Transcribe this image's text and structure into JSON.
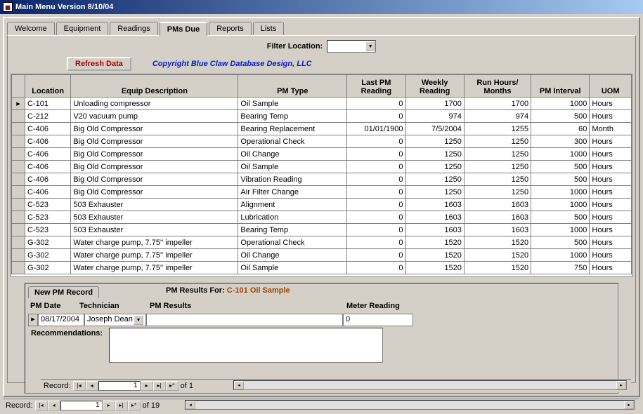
{
  "window": {
    "title": "Main Menu Version 8/10/04"
  },
  "tabs": [
    "Welcome",
    "Equipment",
    "Readings",
    "PMs Due",
    "Reports",
    "Lists"
  ],
  "activeTab": 3,
  "filter": {
    "label": "Filter Location:"
  },
  "refresh": {
    "label": "Refresh Data"
  },
  "copyright": "Copyright Blue Claw Database Design, LLC",
  "columns": [
    "Location",
    "Equip Description",
    "PM Type",
    "Last PM Reading",
    "Weekly Reading",
    "Run Hours/ Months",
    "PM Interval",
    "UOM"
  ],
  "rows": [
    {
      "loc": "C-101",
      "desc": "Unloading compressor",
      "pmtype": "Oil Sample",
      "last": "0",
      "weekly": "1700",
      "run": "1700",
      "interval": "1000",
      "uom": "Hours"
    },
    {
      "loc": "C-212",
      "desc": "V20 vacuum pump",
      "pmtype": "Bearing Temp",
      "last": "0",
      "weekly": "974",
      "run": "974",
      "interval": "500",
      "uom": "Hours"
    },
    {
      "loc": "C-406",
      "desc": "Big Old Compressor",
      "pmtype": "Bearing Replacement",
      "last": "01/01/1900",
      "weekly": "7/5/2004",
      "run": "1255",
      "interval": "60",
      "uom": "Month"
    },
    {
      "loc": "C-406",
      "desc": "Big Old Compressor",
      "pmtype": "Operational Check",
      "last": "0",
      "weekly": "1250",
      "run": "1250",
      "interval": "300",
      "uom": "Hours"
    },
    {
      "loc": "C-406",
      "desc": "Big Old Compressor",
      "pmtype": "Oil Change",
      "last": "0",
      "weekly": "1250",
      "run": "1250",
      "interval": "1000",
      "uom": "Hours"
    },
    {
      "loc": "C-406",
      "desc": "Big Old Compressor",
      "pmtype": "Oil Sample",
      "last": "0",
      "weekly": "1250",
      "run": "1250",
      "interval": "500",
      "uom": "Hours"
    },
    {
      "loc": "C-406",
      "desc": "Big Old Compressor",
      "pmtype": "Vibration Reading",
      "last": "0",
      "weekly": "1250",
      "run": "1250",
      "interval": "500",
      "uom": "Hours"
    },
    {
      "loc": "C-406",
      "desc": "Big Old Compressor",
      "pmtype": "Air Filter Change",
      "last": "0",
      "weekly": "1250",
      "run": "1250",
      "interval": "1000",
      "uom": "Hours"
    },
    {
      "loc": "C-523",
      "desc": "503 Exhauster",
      "pmtype": "Alignment",
      "last": "0",
      "weekly": "1603",
      "run": "1603",
      "interval": "1000",
      "uom": "Hours"
    },
    {
      "loc": "C-523",
      "desc": "503 Exhauster",
      "pmtype": "Lubrication",
      "last": "0",
      "weekly": "1603",
      "run": "1603",
      "interval": "500",
      "uom": "Hours"
    },
    {
      "loc": "C-523",
      "desc": "503 Exhauster",
      "pmtype": "Bearing Temp",
      "last": "0",
      "weekly": "1603",
      "run": "1603",
      "interval": "1000",
      "uom": "Hours"
    },
    {
      "loc": "G-302",
      "desc": "Water charge pump, 7.75'' impeller",
      "pmtype": "Operational Check",
      "last": "0",
      "weekly": "1520",
      "run": "1520",
      "interval": "500",
      "uom": "Hours"
    },
    {
      "loc": "G-302",
      "desc": "Water charge pump, 7.75'' impeller",
      "pmtype": "Oil Change",
      "last": "0",
      "weekly": "1520",
      "run": "1520",
      "interval": "1000",
      "uom": "Hours"
    },
    {
      "loc": "G-302",
      "desc": "Water charge pump, 7.75'' impeller",
      "pmtype": "Oil Sample",
      "last": "0",
      "weekly": "1520",
      "run": "1520",
      "interval": "750",
      "uom": "Hours"
    }
  ],
  "subpanel": {
    "tab": "New PM Record",
    "titlePrefix": "PM Results For:",
    "titleValue": "C-101 Oil Sample",
    "headers": [
      "PM Date",
      "Technician",
      "PM Results",
      "Meter Reading"
    ],
    "row": {
      "date": "08/17/2004",
      "tech": "Joseph Dean",
      "results": "",
      "meter": "0"
    },
    "recoLabel": "Recommendations:"
  },
  "nav": {
    "label": "Record:",
    "innerPos": "1",
    "innerOf": "of  1",
    "outerPos": "1",
    "outerOf": "of  19"
  }
}
